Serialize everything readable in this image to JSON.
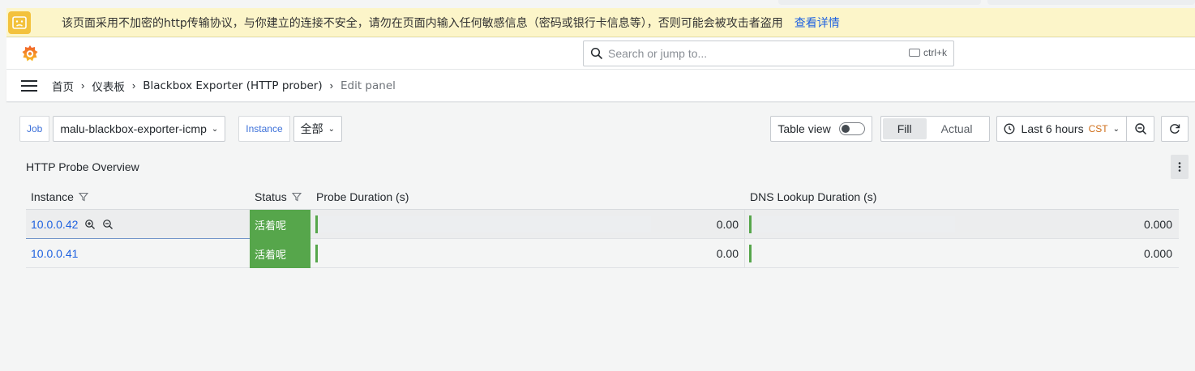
{
  "browser_warning": {
    "text": "该页面采用不加密的http传输协议，与你建立的连接不安全，请勿在页面内输入任何敏感信息（密码或银行卡信息等），否则可能会被攻击者盗用",
    "link": "查看详情",
    "icon": "warning-face-icon"
  },
  "search": {
    "placeholder": "Search or jump to...",
    "shortcut": "ctrl+k"
  },
  "breadcrumbs": [
    {
      "label": "首页"
    },
    {
      "label": "仪表板"
    },
    {
      "label": "Blackbox Exporter (HTTP prober)"
    },
    {
      "label": "Edit panel"
    }
  ],
  "variables": [
    {
      "label": "Job",
      "value": "malu-blackbox-exporter-icmp"
    },
    {
      "label": "Instance",
      "value": "全部"
    }
  ],
  "controls": {
    "table_view": "Table view",
    "table_view_on": false,
    "fill": "Fill",
    "actual": "Actual",
    "selected_mode": "Fill",
    "time_range": "Last 6 hours",
    "timezone": "CST"
  },
  "panel": {
    "title": "HTTP Probe Overview",
    "columns": [
      "Instance",
      "Status",
      "Probe Duration (s)",
      "DNS Lookup Duration (s)"
    ],
    "rows": [
      {
        "instance": "10.0.0.42",
        "status": "活着呢",
        "probe_duration": "0.00",
        "dns_duration": "0.000"
      },
      {
        "instance": "10.0.0.41",
        "status": "活着呢",
        "probe_duration": "0.00",
        "dns_duration": "0.000"
      }
    ]
  },
  "colors": {
    "status_ok": "#56a64b",
    "link": "#1f62e0",
    "warning_bg": "#fcf5c9",
    "timezone": "#cf6f1b"
  }
}
